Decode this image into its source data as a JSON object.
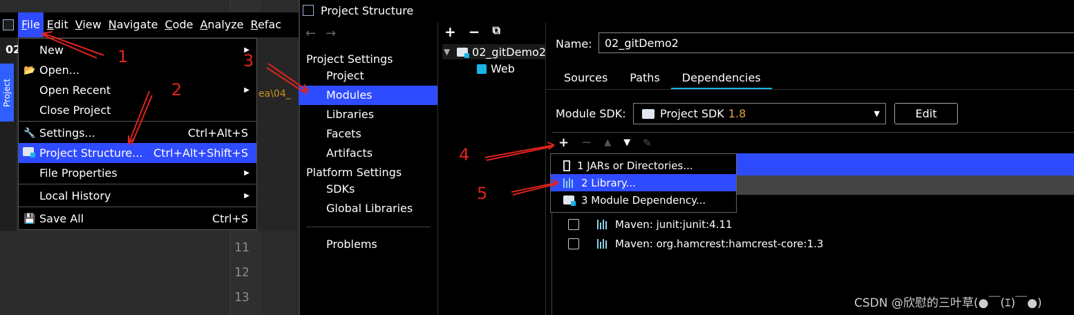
{
  "menubar": {
    "items": [
      "File",
      "Edit",
      "View",
      "Navigate",
      "Code",
      "Analyze",
      "Refac"
    ]
  },
  "ide": {
    "project_tab": "Project",
    "title_frag": "02",
    "path_frag": "ea\\04_",
    "line_numbers": [
      "11",
      "12",
      "13"
    ]
  },
  "file_menu": {
    "new": "New",
    "open": "Open...",
    "open_recent": "Open Recent",
    "close_project": "Close Project",
    "settings": "Settings...",
    "settings_shortcut": "Ctrl+Alt+S",
    "project_structure": "Project Structure...",
    "project_structure_shortcut": "Ctrl+Alt+Shift+S",
    "file_properties": "File Properties",
    "local_history": "Local History",
    "save_all": "Save All",
    "save_all_shortcut": "Ctrl+S"
  },
  "dialog": {
    "title": "Project Structure",
    "project_settings_header": "Project Settings",
    "project_settings": [
      "Project",
      "Modules",
      "Libraries",
      "Facets",
      "Artifacts"
    ],
    "platform_settings_header": "Platform Settings",
    "platform_settings": [
      "SDKs",
      "Global Libraries"
    ],
    "problems": "Problems",
    "tree": {
      "root": "02_gitDemo2",
      "child": "Web"
    },
    "name_label": "Name:",
    "name_value": "02_gitDemo2",
    "tabs": [
      "Sources",
      "Paths",
      "Dependencies"
    ],
    "sdk_label": "Module SDK:",
    "sdk_value": "Project SDK",
    "sdk_version": "1.8",
    "edit_button": "Edit",
    "add_popup": [
      "1  JARs or Directories...",
      "2  Library...",
      "3  Module Dependency..."
    ],
    "dependencies": [
      "Maven: junit:junit:4.11",
      "Maven: org.hamcrest:hamcrest-core:1.3"
    ]
  },
  "annotations": [
    "1",
    "2",
    "3",
    "4",
    "5"
  ],
  "watermark": "CSDN @欣慰的三叶草(●￣(ｴ)￣●)",
  "colors": {
    "selection": "#2f4bff",
    "accent": "#19b3e8",
    "annotation": "#e0231c",
    "sdk_version": "#e6a23c"
  }
}
